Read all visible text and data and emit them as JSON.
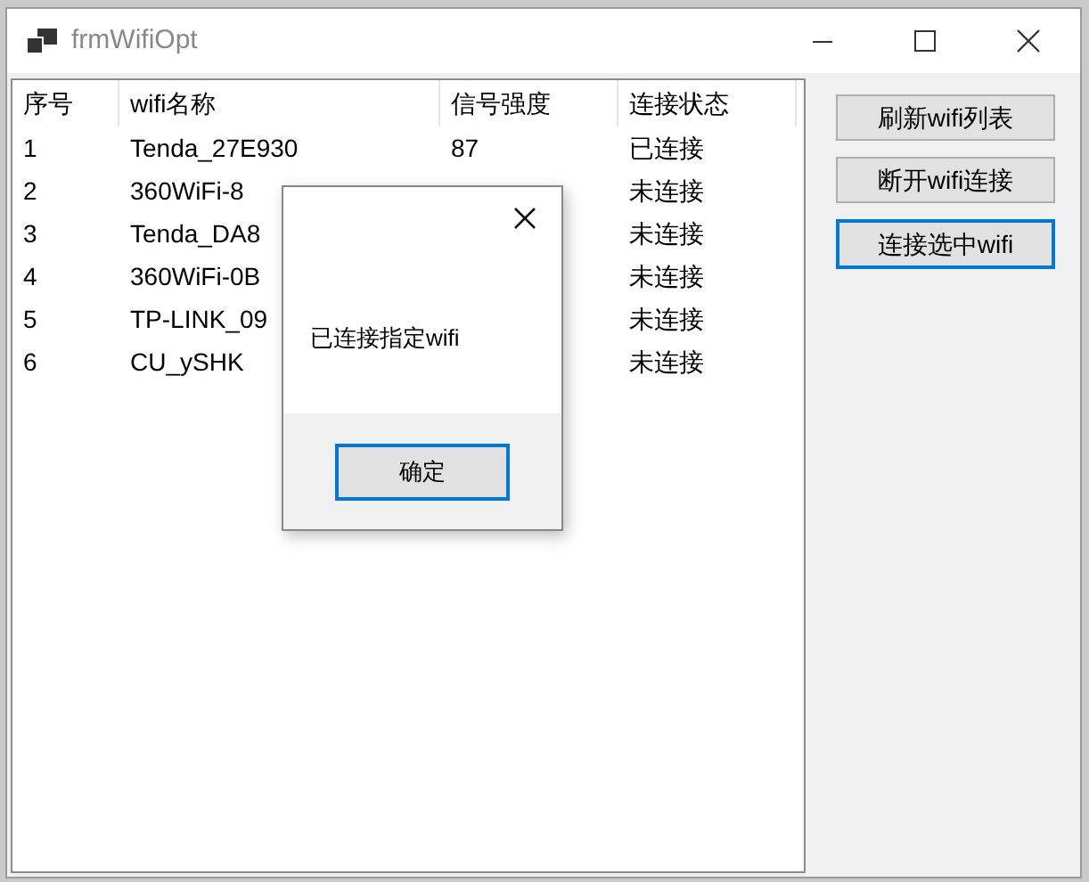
{
  "window": {
    "title": "frmWifiOpt"
  },
  "table": {
    "columns": [
      "序号",
      "wifi名称",
      "信号强度",
      "连接状态"
    ],
    "rows": [
      {
        "index": "1",
        "name": "Tenda_27E930",
        "signal": "87",
        "status": "已连接"
      },
      {
        "index": "2",
        "name": "360WiFi-8",
        "status": "未连接"
      },
      {
        "index": "3",
        "name": "Tenda_DA8",
        "status": "未连接"
      },
      {
        "index": "4",
        "name": "360WiFi-0B",
        "status": "未连接"
      },
      {
        "index": "5",
        "name": "TP-LINK_09",
        "status": "未连接"
      },
      {
        "index": "6",
        "name": "CU_ySHK",
        "status": "未连接"
      }
    ]
  },
  "buttons": [
    {
      "label": "刷新wifi列表",
      "focused": false
    },
    {
      "label": "断开wifi连接",
      "focused": false
    },
    {
      "label": "连接选中wifi",
      "focused": true
    }
  ],
  "dialog": {
    "message": "已连接指定wifi",
    "ok_button": {
      "label": "确定",
      "focused": true
    }
  }
}
